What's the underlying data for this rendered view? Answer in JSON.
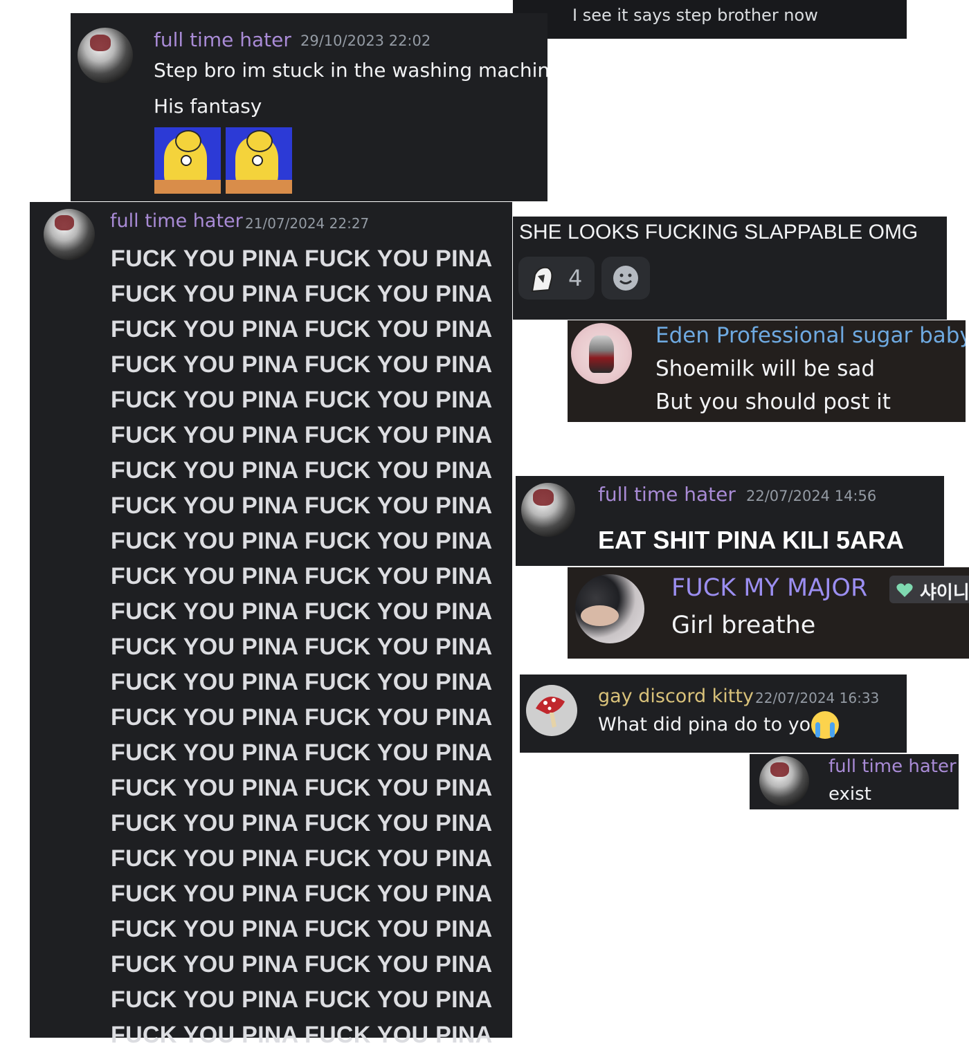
{
  "panel_top_right": {
    "message": "I see it says step brother now"
  },
  "post1": {
    "username": "full time hater",
    "timestamp": "29/10/2023 22:02",
    "lines": [
      "Step bro im stuck in the washing machine",
      "His fantasy"
    ],
    "attachments": [
      "image-1",
      "image-2"
    ]
  },
  "post2": {
    "username": "full time hater",
    "timestamp": "21/07/2024 22:27",
    "spam_lines": [
      "FUCK YOU PINA FUCK YOU PINA",
      "FUCK YOU PINA FUCK YOU PINA",
      "FUCK YOU PINA FUCK YOU PINA",
      "FUCK YOU PINA FUCK YOU PINA",
      "FUCK YOU PINA FUCK YOU PINA",
      "FUCK YOU PINA FUCK YOU PINA",
      "FUCK YOU PINA FUCK YOU PINA",
      "FUCK YOU PINA FUCK YOU PINA",
      "FUCK YOU PINA FUCK YOU PINA",
      "FUCK YOU PINA FUCK YOU PINA",
      "FUCK YOU PINA FUCK YOU PINA",
      "FUCK YOU PINA FUCK YOU PINA",
      "FUCK YOU PINA FUCK YOU PINA",
      "FUCK YOU PINA FUCK YOU PINA",
      "FUCK YOU PINA FUCK YOU PINA",
      "FUCK YOU PINA FUCK YOU PINA",
      "FUCK YOU PINA FUCK YOU PINA",
      "FUCK YOU PINA FUCK YOU PINA",
      "FUCK YOU PINA FUCK YOU PINA",
      "FUCK YOU PINA FUCK YOU PINA",
      "FUCK YOU PINA FUCK YOU PINA",
      "FUCK YOU PINA FUCK YOU PINA",
      "FUCK YOU PINA FUCK YOU PINA"
    ]
  },
  "slappable": {
    "message": "SHE LOOKS FUCKING SLAPPABLE OMG",
    "reaction_count": "4",
    "reaction_emoji": "custom-emoji-icon",
    "add_reaction_icon": "add-reaction-icon"
  },
  "eden": {
    "username": "Eden Professional sugar baby",
    "lines": [
      "Shoemilk will be sad",
      "But you should post it"
    ]
  },
  "post3": {
    "username": "full time hater",
    "timestamp": "22/07/2024 14:56",
    "message": "EAT SHIT PINA KILI 5ARA"
  },
  "major": {
    "username": "FUCK MY MAJOR",
    "tag": "샤이니",
    "tag_icon": "heart-icon",
    "message": "Girl breathe"
  },
  "kitty": {
    "username": "gay discord kitty",
    "timestamp": "22/07/2024 16:33",
    "message": "What did pina do to you",
    "emoji": "crying-emoji-icon"
  },
  "reply": {
    "username": "full time hater",
    "message": "exist"
  },
  "colors": {
    "hater_name": "#a98bd6",
    "eden_name": "#6ea9e0",
    "major_name": "#9b8ef0",
    "kitty_name": "#d9c27a",
    "panel_bg": "#1e1f22"
  }
}
